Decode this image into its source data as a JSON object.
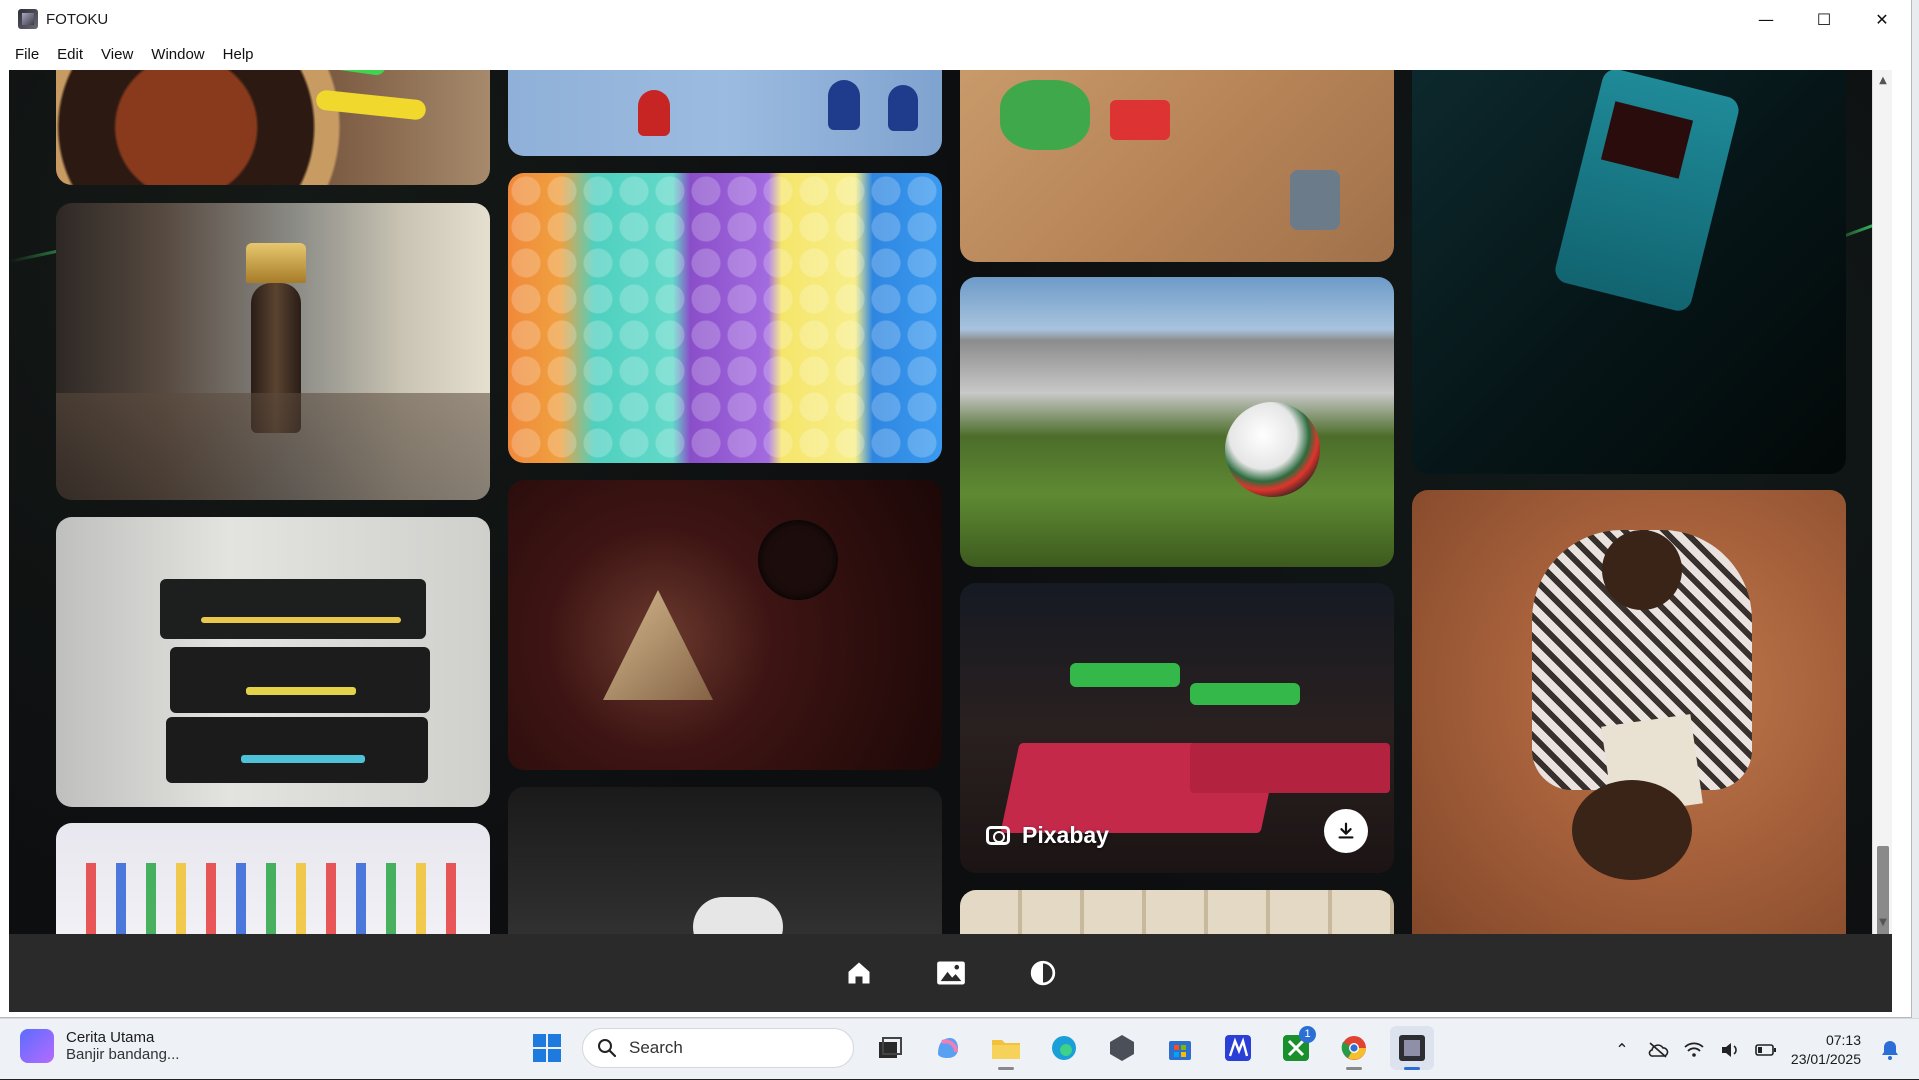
{
  "window": {
    "title": "FOTOKU",
    "controls": {
      "minimize": "—",
      "maximize": "☐",
      "close": "✕"
    }
  },
  "menu": [
    "File",
    "Edit",
    "View",
    "Window",
    "Help"
  ],
  "gallery": {
    "hover_caption": "Pixabay",
    "tiles": [
      {
        "name": "darts-photo"
      },
      {
        "name": "chess-king-pawn-photo"
      },
      {
        "name": "atari-cartridges-photo"
      },
      {
        "name": "board-game-pawns-photo"
      },
      {
        "name": "board-game-pieces-photo"
      },
      {
        "name": "plush-toys-photo"
      },
      {
        "name": "shield-controller-photo"
      },
      {
        "name": "gamepad-bw-photo"
      },
      {
        "name": "toy-pieces-photo"
      },
      {
        "name": "soccer-stadium-photo"
      },
      {
        "name": "billiard-bar-photo"
      },
      {
        "name": "wooden-blocks-photo"
      },
      {
        "name": "gameboy-hands-photo"
      },
      {
        "name": "board-game-players-photo"
      }
    ]
  },
  "bottom_nav": [
    {
      "icon": "home-icon"
    },
    {
      "icon": "gallery-icon"
    },
    {
      "icon": "theme-toggle-icon"
    }
  ],
  "taskbar": {
    "widget_title": "Cerita Utama",
    "widget_subtitle": "Banjir bandang...",
    "search_placeholder": "Search",
    "xbox_badge": "1",
    "time": "07:13",
    "date": "23/01/2025"
  }
}
